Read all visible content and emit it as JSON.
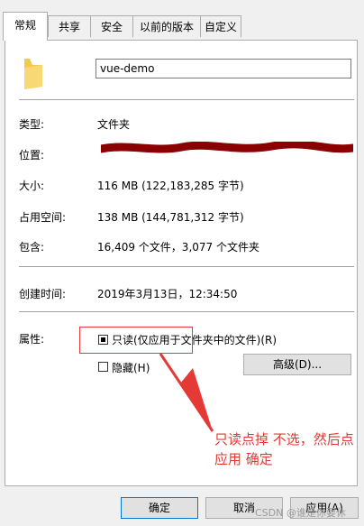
{
  "tabs": [
    "常规",
    "共享",
    "安全",
    "以前的版本",
    "自定义"
  ],
  "name": {
    "value": "vue-demo"
  },
  "properties": [
    {
      "label": "类型:",
      "value": "文件夹"
    },
    {
      "label": "位置:",
      "value": ""
    },
    {
      "label": "大小:",
      "value": "116 MB (122,183,285 字节)"
    },
    {
      "label": "占用空间:",
      "value": "138 MB (144,781,312 字节)"
    },
    {
      "label": "包含:",
      "value": "16,409 个文件，3,077 个文件夹"
    },
    {
      "label": "创建时间:",
      "value": "2019年3月13日，12:34:50"
    }
  ],
  "attributes": {
    "label": "属性:",
    "readonly_label": "只读(仅应用于文件夹中的文件)(R)",
    "hidden_label": "隐藏(H)",
    "advanced_label": "高级(D)..."
  },
  "annotation": {
    "text": "只读点掉 不选，然后点应用 确定",
    "color": "#e53935"
  },
  "footer": {
    "ok_label": "确定",
    "cancel_label": "取消",
    "apply_label": "应用(A)"
  },
  "watermark": "CSDN @谁是你要休"
}
